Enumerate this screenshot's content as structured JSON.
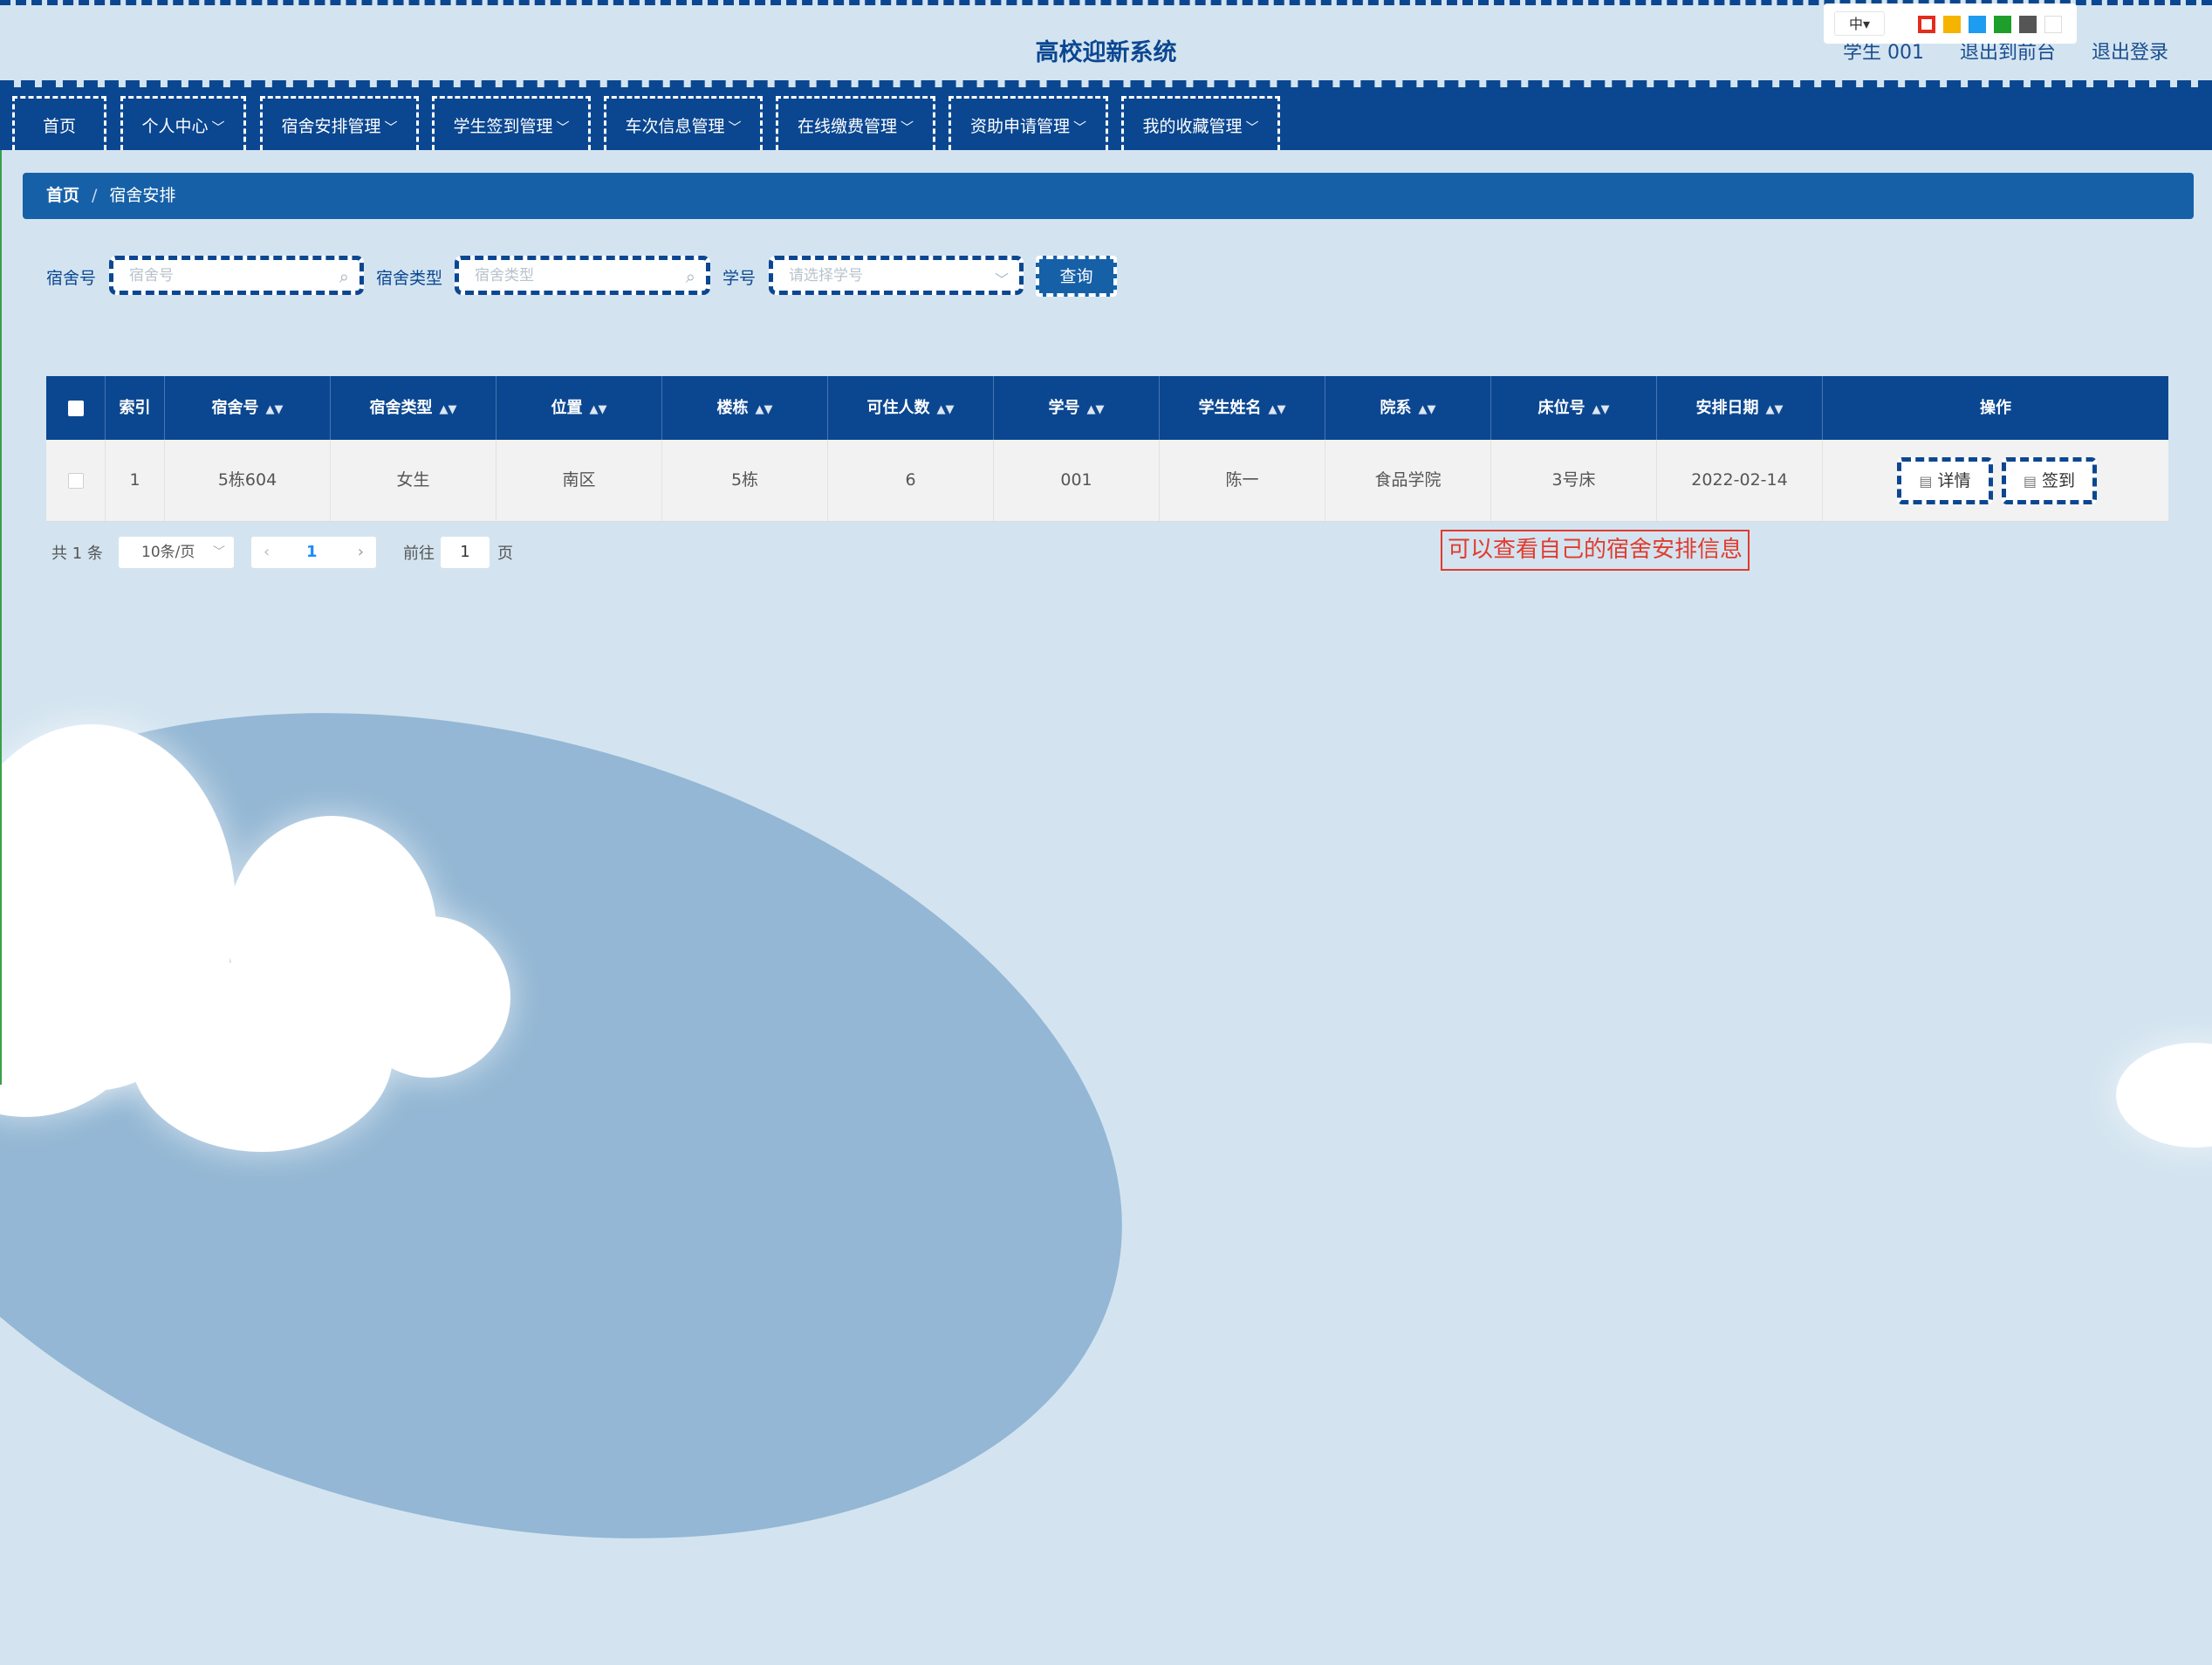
{
  "header": {
    "title": "高校迎新系统",
    "user_label": "学生 001",
    "back_to_front": "退出到前台",
    "logout": "退出登录",
    "lang_button": "中▾",
    "theme_swatches": [
      "#e52b1c",
      "#f5b400",
      "#1e9cf0",
      "#1e9f2c",
      "#555555",
      "#ffffff"
    ]
  },
  "nav": {
    "items": [
      {
        "label": "首页",
        "has_menu": false
      },
      {
        "label": "个人中心",
        "has_menu": true
      },
      {
        "label": "宿舍安排管理",
        "has_menu": true
      },
      {
        "label": "学生签到管理",
        "has_menu": true
      },
      {
        "label": "车次信息管理",
        "has_menu": true
      },
      {
        "label": "在线缴费管理",
        "has_menu": true
      },
      {
        "label": "资助申请管理",
        "has_menu": true
      },
      {
        "label": "我的收藏管理",
        "has_menu": true
      }
    ]
  },
  "breadcrumb": {
    "home": "首页",
    "separator": "/",
    "current": "宿舍安排"
  },
  "search": {
    "dorm_no_label": "宿舍号",
    "dorm_no_placeholder": "宿舍号",
    "dorm_type_label": "宿舍类型",
    "dorm_type_placeholder": "宿舍类型",
    "student_no_label": "学号",
    "student_no_placeholder": "请选择学号",
    "query_button": "查询"
  },
  "table": {
    "columns": [
      "索引",
      "宿舍号",
      "宿舍类型",
      "位置",
      "楼栋",
      "可住人数",
      "学号",
      "学生姓名",
      "院系",
      "床位号",
      "安排日期",
      "操作"
    ],
    "rows": [
      {
        "cells": [
          "1",
          "5栋604",
          "女生",
          "南区",
          "5栋",
          "6",
          "001",
          "陈一",
          "食品学院",
          "3号床",
          "2022-02-14"
        ],
        "detail_button": "详情",
        "checkin_button": "签到"
      }
    ]
  },
  "pagination": {
    "total": "共 1 条",
    "page_size": "10条/页",
    "current_page": "1",
    "goto_label": "前往",
    "goto_value": "1",
    "goto_suffix": "页"
  },
  "annotation": "可以查看自己的宿舍安排信息",
  "colors": {
    "primary": "#0b4791",
    "breadcrumb": "#1660a8",
    "background": "#d3e4f0",
    "annotation": "#e23b2e"
  }
}
